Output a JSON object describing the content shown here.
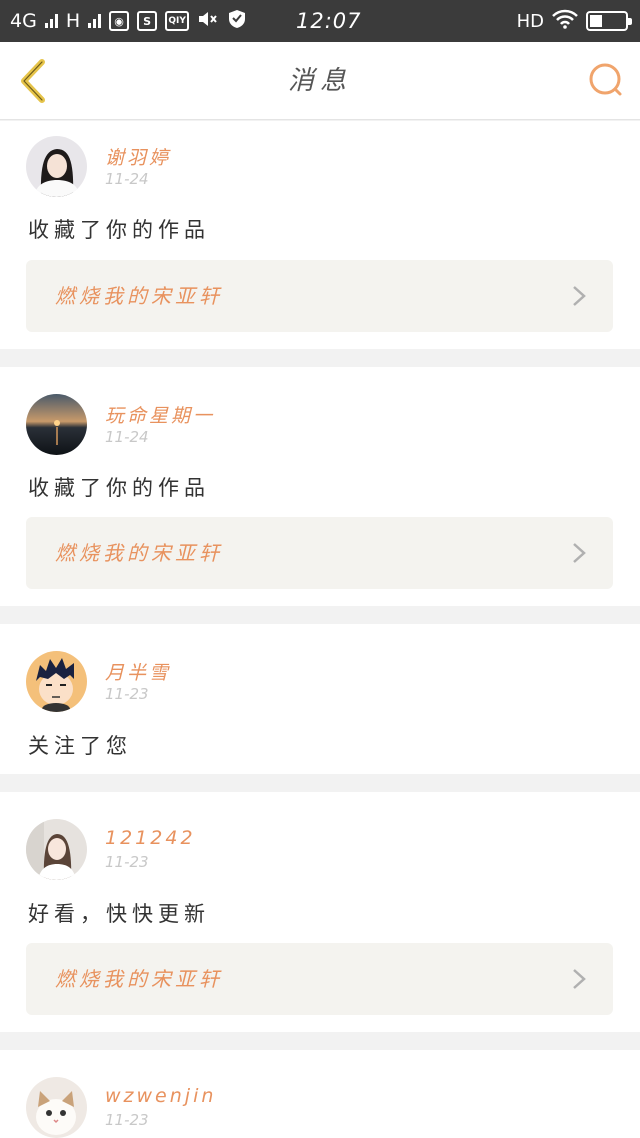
{
  "status_bar": {
    "network": "4G",
    "signal2": "H",
    "icon_s": "S",
    "icon_qiyi": "QIY",
    "time": "12:07",
    "hd": "HD",
    "icons": [
      "signal-icon",
      "globe-icon",
      "qiyi-icon",
      "mute-icon",
      "shield-icon",
      "wifi-icon",
      "battery-icon"
    ]
  },
  "header": {
    "title": "消息"
  },
  "colors": {
    "accent": "#e8925e",
    "back_arrow": "#e6c44a",
    "status_bar_bg": "#3b3b3b",
    "card_link_bg": "#f4f3ef"
  },
  "messages": [
    {
      "username": "谢羽婷",
      "date": "11-24",
      "text": "收藏了你的作品",
      "work_title": "燃烧我的宋亚轩"
    },
    {
      "username": "玩命星期一",
      "date": "11-24",
      "text": "收藏了你的作品",
      "work_title": "燃烧我的宋亚轩"
    },
    {
      "username": "月半雪",
      "date": "11-23",
      "text": "关注了您"
    },
    {
      "username": "121242",
      "date": "11-23",
      "text": "好看，快快更新",
      "work_title": "燃烧我的宋亚轩"
    },
    {
      "username": "wzwenjin",
      "date": "11-23"
    }
  ]
}
